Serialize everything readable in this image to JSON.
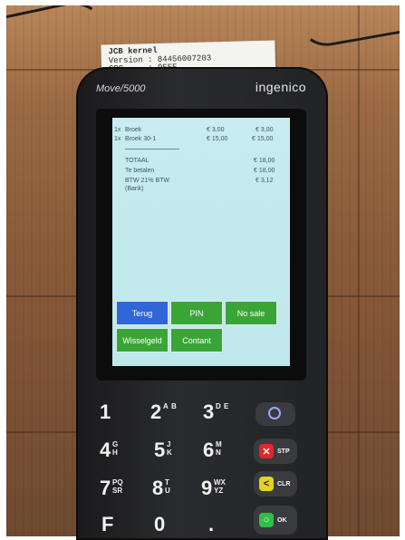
{
  "receipt": {
    "line1": "JCB kernel",
    "line2": "Version : 84456007203",
    "line3": "CRC     : 9FFE"
  },
  "terminal": {
    "model": "Move/5000",
    "brand": "ingenico"
  },
  "screen": {
    "items": [
      {
        "qty": "1x",
        "name": "Broek",
        "unit": "€ 3,00",
        "total": "€ 3,00"
      },
      {
        "qty": "1x",
        "name": "Broek 30-1",
        "unit": "€ 15,00",
        "total": "€ 15,00"
      }
    ],
    "summary": [
      {
        "label": "TOTAAL",
        "value": "€ 18,00"
      },
      {
        "label": "Te betalen",
        "value": "€ 18,00"
      },
      {
        "label": "BTW 21% BTW",
        "value": "€ 3,12"
      },
      {
        "label": "(Bank)",
        "value": ""
      }
    ],
    "buttons": {
      "terug": "Terug",
      "pin": "PIN",
      "no_sale": "No sale",
      "wisselgeld": "Wisselgeld",
      "contant": "Contant"
    }
  },
  "keypad": {
    "k1": "1",
    "k2": "2",
    "k2_sub_a": "A",
    "k2_sub_b": "B",
    "k3": "3",
    "k3_sub_a": "D",
    "k3_sub_b": "E",
    "k4": "4",
    "k4_sub_a": "G",
    "k4_sub_b": "H",
    "k5": "5",
    "k5_sub_a": "J",
    "k5_sub_b": "K",
    "k6": "6",
    "k6_sub_a": "M",
    "k6_sub_b": "N",
    "k7": "7",
    "k7_sub_a": "PQ",
    "k7_sub_b": "SR",
    "k8": "8",
    "k8_sub_a": "T",
    "k8_sub_b": "U",
    "k9": "9",
    "k9_sub_a": "WX",
    "k9_sub_b": "YZ",
    "kf": "F",
    "k0": "0",
    "kdot": ".",
    "stop_label": "STP",
    "clear_label": "CLR",
    "ok_label": "OK",
    "stop_glyph": "✕",
    "clear_glyph": "<",
    "ok_glyph": "○"
  },
  "colors": {
    "stop": "#e0262a",
    "clear": "#e6d21e",
    "ok": "#2fbf4a",
    "screen_blue_button": "#2f66d8",
    "screen_green_button": "#3aa536"
  }
}
